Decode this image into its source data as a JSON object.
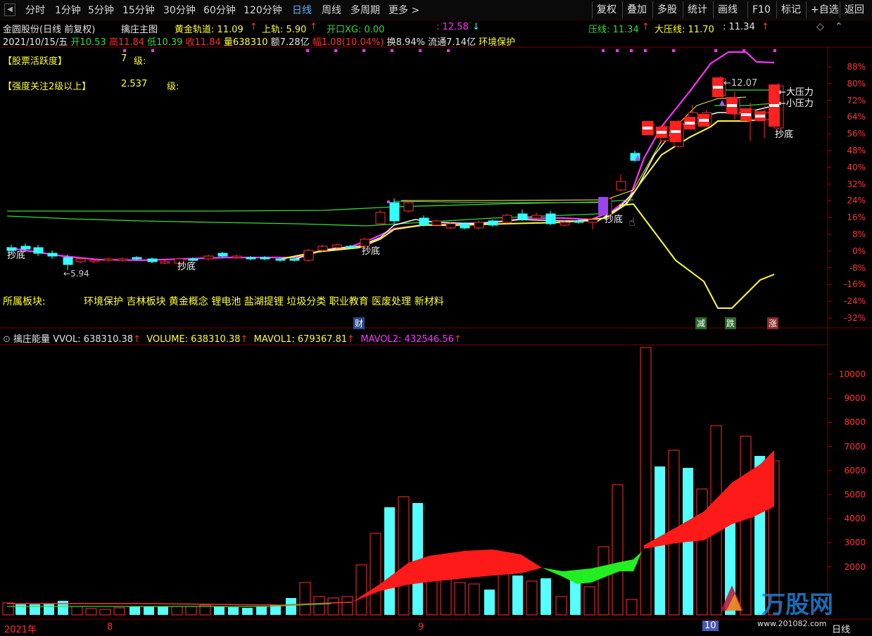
{
  "toolbar": {
    "tabs": [
      "分时",
      "1分钟",
      "5分钟",
      "15分钟",
      "30分钟",
      "60分钟",
      "120分钟",
      "日线",
      "周线",
      "多周期",
      "更多 >"
    ],
    "active_index": 7,
    "right_buttons": [
      "复权",
      "叠加",
      "多股",
      "统计",
      "画线",
      "F10",
      "标记",
      "+自选",
      "返回"
    ]
  },
  "header": {
    "stock": "金圆股份(日线 前复权)",
    "indicator_name": "擒庄主图",
    "golden_rail": "黄金轨道: 11.09",
    "upper_rail": "上轨: 5.90",
    "open_xg": "开口XG: 0.00",
    "time_value": ": 12.58",
    "pressure": "压线: 11.34",
    "big_pressure": "大压线: 11.70",
    "pressure_value": ": 11.34",
    "date": "2021/10/15/五",
    "open": "开10.53",
    "high": "高11.84",
    "low": "低10.39",
    "close": "收11.84",
    "vol": "量638310",
    "amount": "额7.28亿",
    "change": "幅1.08(10.04%)",
    "turnover": "换8.94%",
    "float": "流通7.14亿",
    "concept": "环境保护"
  },
  "main_panel": {
    "activity_label": "【股票活跃度】",
    "activity_value": "7",
    "activity_unit": "级:",
    "strength_label": "【强度关注2级以上】",
    "strength_value": "2.537",
    "strength_unit": "级:",
    "sector_label": "所属板块:",
    "sectors": "环境保护 吉林板块 黄金概念 锂电池 盐湖提锂 垃圾分类 职业教育 医废处理 新材料",
    "annotations": {
      "bottom_1": "抄底",
      "bottom_2": "抄底",
      "bottom_3": "抄底",
      "bottom_4": "抄底",
      "bottom_5": "抄底",
      "low_price": "5.94",
      "high_price": "12.07",
      "big_pressure": "大压力",
      "small_pressure": "小压力",
      "cai": "财",
      "jian": "减",
      "die": "跌",
      "zhang": "涨"
    },
    "y_axis": [
      "88%",
      "80%",
      "72%",
      "64%",
      "56%",
      "48%",
      "40%",
      "32%",
      "24%",
      "16%",
      "8%",
      "0%",
      "-8%",
      "-16%",
      "-24%",
      "-32%"
    ]
  },
  "volume_panel": {
    "title": "擒庄能量",
    "vvol": "VVOL: 638310.38",
    "volume": "VOLUME: 638310.38",
    "mavol1": "MAVOL1: 679367.81",
    "mavol2": "MAVOL2: 432546.56",
    "y_axis": [
      "10000",
      "9000",
      "8000",
      "7000",
      "6000",
      "5000",
      "4000",
      "3000",
      "2000"
    ]
  },
  "x_axis": {
    "labels": [
      "2021年",
      "8",
      "9",
      "10"
    ],
    "period": "日线"
  },
  "colors": {
    "up": "#ff3030",
    "down": "#33ffff",
    "yellow": "#ffff33",
    "magenta": "#ff33ff",
    "green": "#33dd33"
  },
  "watermark": {
    "brand": "万股网",
    "url": "www.201082.com"
  }
}
